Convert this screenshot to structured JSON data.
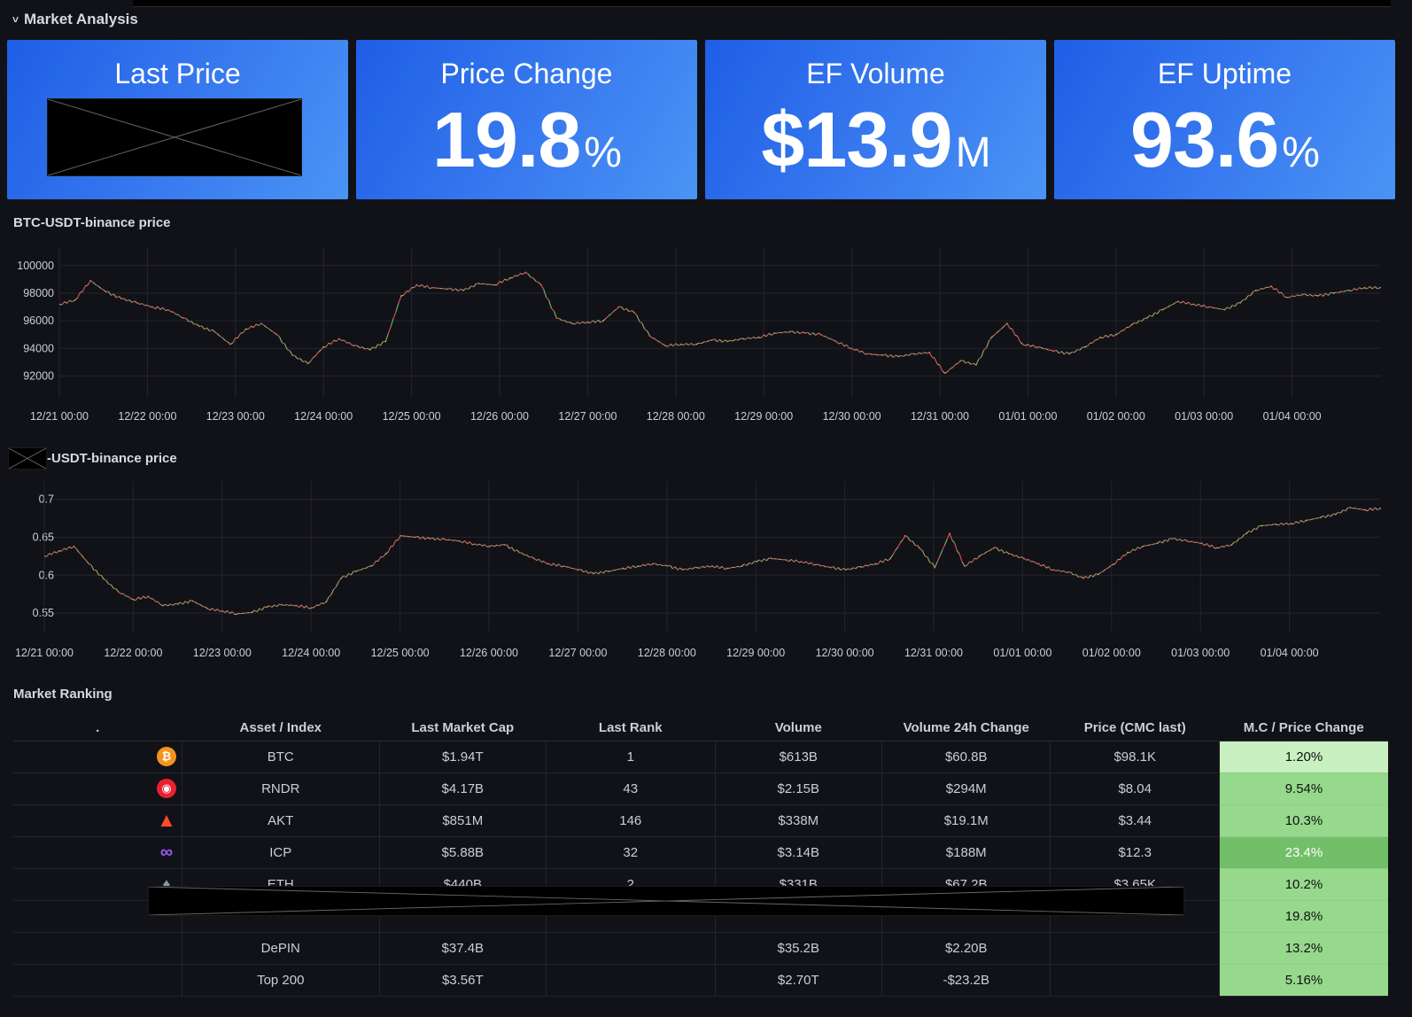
{
  "row": {
    "chevron": "˅",
    "title": "Market Analysis"
  },
  "stats": [
    {
      "title": "Last Price",
      "value": "",
      "unit": ""
    },
    {
      "title": "Price Change",
      "value": "19.8",
      "unit": "%"
    },
    {
      "title": "EF Volume",
      "value": "$13.9",
      "unit": "M"
    },
    {
      "title": "EF Uptime",
      "value": "93.6",
      "unit": "%"
    }
  ],
  "chart1": {
    "title": "BTC-USDT-binance price",
    "chart_data": {
      "type": "line",
      "title": "BTC-USDT-binance price",
      "ylim": [
        91000,
        100500
      ],
      "y_ticks": [
        "100000",
        "98000",
        "96000",
        "94000",
        "92000"
      ],
      "x_ticks": [
        "12/21 00:00",
        "12/22 00:00",
        "12/23 00:00",
        "12/24 00:00",
        "12/25 00:00",
        "12/26 00:00",
        "12/27 00:00",
        "12/28 00:00",
        "12/29 00:00",
        "12/30 00:00",
        "12/31 00:00",
        "01/01 00:00",
        "01/02 00:00",
        "01/03 00:00",
        "01/04 00:00"
      ],
      "series": [
        {
          "values": [
            97200,
            97500,
            98900,
            98100,
            97600,
            97300,
            97000,
            96800,
            96200,
            95600,
            95200,
            94300,
            95400,
            95800,
            95000,
            93500,
            92900,
            94100,
            94700,
            94200,
            93900,
            94500,
            97800,
            98600,
            98400,
            98300,
            98200,
            98700,
            98600,
            99100,
            99500,
            98600,
            96200,
            95800,
            95900,
            96000,
            97000,
            96600,
            94900,
            94200,
            94300,
            94300,
            94600,
            94500,
            94700,
            94800,
            95100,
            95200,
            95100,
            95000,
            94500,
            94000,
            93600,
            93500,
            93400,
            93600,
            93700,
            92200,
            93100,
            92800,
            94800,
            95800,
            94300,
            94100,
            93800,
            93600,
            94100,
            94800,
            95000,
            95700,
            96200,
            96800,
            97400,
            97200,
            97000,
            96800,
            97300,
            98200,
            98500,
            97700,
            97900,
            97800,
            98000,
            98200,
            98400,
            98400
          ]
        }
      ]
    }
  },
  "chart2": {
    "title": "-USDT-binance price",
    "chart_data": {
      "type": "line",
      "title": "-USDT-binance price",
      "ylim": [
        0.535,
        0.71
      ],
      "y_ticks": [
        "0.7",
        "0.65",
        "0.6",
        "0.55"
      ],
      "x_ticks": [
        "12/21 00:00",
        "12/22 00:00",
        "12/23 00:00",
        "12/24 00:00",
        "12/25 00:00",
        "12/26 00:00",
        "12/27 00:00",
        "12/28 00:00",
        "12/29 00:00",
        "12/30 00:00",
        "12/31 00:00",
        "01/01 00:00",
        "01/02 00:00",
        "01/03 00:00",
        "01/04 00:00"
      ],
      "series": [
        {
          "values": [
            0.625,
            0.632,
            0.638,
            0.615,
            0.595,
            0.578,
            0.568,
            0.572,
            0.56,
            0.562,
            0.566,
            0.556,
            0.553,
            0.549,
            0.551,
            0.558,
            0.561,
            0.56,
            0.557,
            0.565,
            0.596,
            0.605,
            0.612,
            0.628,
            0.652,
            0.65,
            0.648,
            0.647,
            0.645,
            0.641,
            0.638,
            0.64,
            0.63,
            0.622,
            0.615,
            0.612,
            0.607,
            0.602,
            0.605,
            0.609,
            0.612,
            0.615,
            0.612,
            0.607,
            0.61,
            0.612,
            0.609,
            0.612,
            0.618,
            0.622,
            0.62,
            0.618,
            0.614,
            0.61,
            0.607,
            0.611,
            0.615,
            0.622,
            0.652,
            0.635,
            0.61,
            0.655,
            0.612,
            0.625,
            0.636,
            0.628,
            0.622,
            0.615,
            0.607,
            0.604,
            0.596,
            0.601,
            0.614,
            0.63,
            0.638,
            0.642,
            0.648,
            0.645,
            0.642,
            0.636,
            0.64,
            0.655,
            0.665,
            0.667,
            0.668,
            0.672,
            0.676,
            0.68,
            0.689,
            0.686,
            0.688
          ]
        }
      ]
    }
  },
  "ranking": {
    "title": "Market Ranking",
    "columns": [
      ".",
      "Asset / Index",
      "Last Market Cap",
      "Last Rank",
      "Volume",
      "Volume 24h Change",
      "Price (CMC last)",
      "M.C / Price Change"
    ],
    "rows": [
      {
        "icon": "bitcoin-icon",
        "asset": "BTC",
        "mcap": "$1.94T",
        "rank": "1",
        "volume": "$613B",
        "vchange": "$60.8B",
        "price": "$98.1K",
        "change": "1.20%",
        "change_pct": 1.2
      },
      {
        "icon": "render-icon",
        "asset": "RNDR",
        "mcap": "$4.17B",
        "rank": "43",
        "volume": "$2.15B",
        "vchange": "$294M",
        "price": "$8.04",
        "change": "9.54%",
        "change_pct": 9.54
      },
      {
        "icon": "akash-icon",
        "asset": "AKT",
        "mcap": "$851M",
        "rank": "146",
        "volume": "$338M",
        "vchange": "$19.1M",
        "price": "$3.44",
        "change": "10.3%",
        "change_pct": 10.3
      },
      {
        "icon": "icp-infinity-icon",
        "asset": "ICP",
        "mcap": "$5.88B",
        "rank": "32",
        "volume": "$3.14B",
        "vchange": "$188M",
        "price": "$12.3",
        "change": "23.4%",
        "change_pct": 23.4
      },
      {
        "icon": "ethereum-icon",
        "asset": "ETH",
        "mcap": "$440B",
        "rank": "2",
        "volume": "$331B",
        "vchange": "$67.2B",
        "price": "$3.65K",
        "change": "10.2%",
        "change_pct": 10.2
      },
      {
        "icon": "",
        "asset": "",
        "mcap": "",
        "rank": "",
        "volume": "",
        "vchange": "",
        "price": "",
        "change": "19.8%",
        "change_pct": 19.8
      },
      {
        "icon": "",
        "asset": "DePIN",
        "mcap": "$37.4B",
        "rank": "",
        "volume": "$35.2B",
        "vchange": "$2.20B",
        "price": "",
        "change": "13.2%",
        "change_pct": 13.2
      },
      {
        "icon": "",
        "asset": "Top 200",
        "mcap": "$3.56T",
        "rank": "",
        "volume": "$2.70T",
        "vchange": "-$23.2B",
        "price": "",
        "change": "5.16%",
        "change_pct": 5.16
      }
    ]
  },
  "colors": {
    "background": "#111217",
    "stat_gradient_start": "#1f5ee6",
    "stat_gradient_end": "#4a94f5",
    "candle_up": "#73bf69",
    "candle_down": "#f2495c",
    "change_light": "#c8f0c0",
    "change_mid": "#96d98d",
    "change_strong": "#73bf69"
  }
}
